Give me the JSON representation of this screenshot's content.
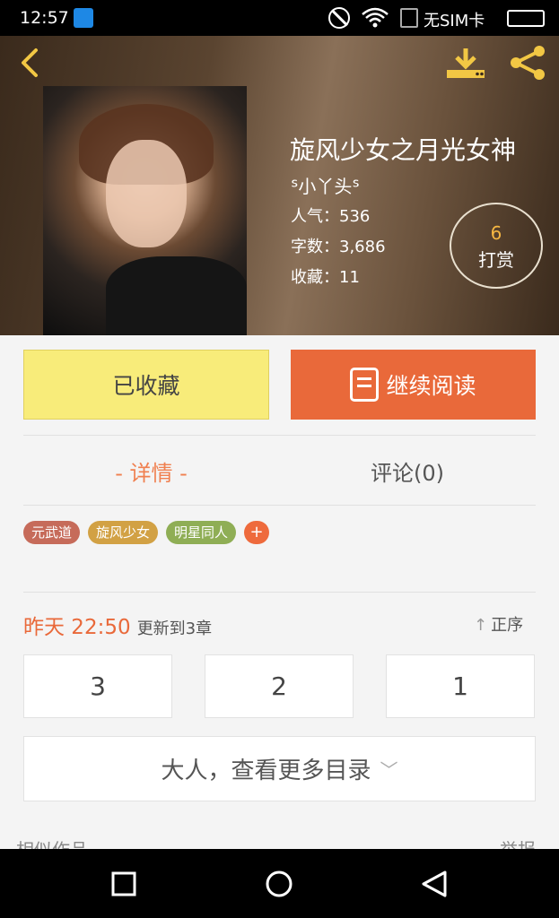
{
  "status_bar": {
    "time": "12:57",
    "sim_text": "无SIM卡"
  },
  "book": {
    "title": "旋风少女之月光女神",
    "author": "ᔆ小丫头ᔆ",
    "popularity_label": "人气：",
    "popularity": "536",
    "word_count_label": "字数：",
    "word_count": "3,686",
    "favorites_label": "收藏：",
    "favorites": "11",
    "tip_count": "6",
    "tip_label": "打赏"
  },
  "actions": {
    "favorited_label": "已收藏",
    "continue_label": "继续阅读"
  },
  "tabs": {
    "detail": "- 详情 -",
    "comments": "评论(0)"
  },
  "tags": [
    "元武道",
    "旋风少女",
    "明星同人"
  ],
  "tag_add": "+",
  "update": {
    "time": "昨天 22:50",
    "text": "更新到3章",
    "order_label": "正序"
  },
  "chapters": [
    "3",
    "2",
    "1"
  ],
  "more_catalog": "大人，查看更多目录",
  "similar_works": "相似作品",
  "report": "举报",
  "colors": {
    "accent": "#e9693a",
    "favorite_bg": "#f8ec7a",
    "tip_num": "#f5b642"
  }
}
